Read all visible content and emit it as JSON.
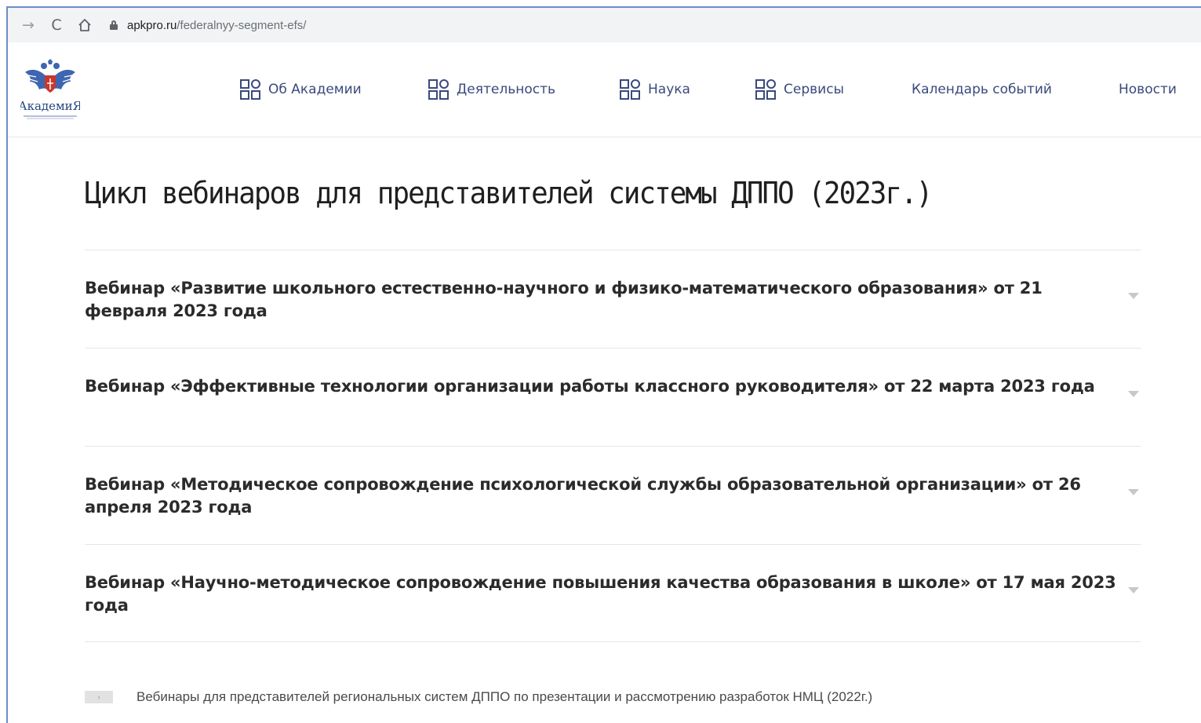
{
  "browser": {
    "url_host": "apkpro.ru",
    "url_path": "/federalnyy-segment-efs/",
    "forward_icon": "→",
    "reload_icon": "C",
    "home_icon": "⌂"
  },
  "header": {
    "logo_text": "АкадемиЯ",
    "nav": [
      {
        "label": "Об Академии",
        "icon": "grid-icon"
      },
      {
        "label": "Деятельность",
        "icon": "grid-icon"
      },
      {
        "label": "Наука",
        "icon": "grid-icon"
      },
      {
        "label": "Сервисы",
        "icon": "grid-icon"
      },
      {
        "label": "Календарь событий"
      },
      {
        "label": "Новости"
      }
    ]
  },
  "main": {
    "title": "Цикл вебинаров для представителей системы ДППО (2023г.)",
    "webinars": [
      {
        "title": "Вебинар «Развитие школьного естественно-научного и физико-математического образования» от 21 февраля 2023 года"
      },
      {
        "title": "Вебинар «Эффективные технологии организации работы классного руководителя» от 22 марта 2023 года"
      },
      {
        "title": "Вебинар «Методическое сопровождение психологической службы образовательной организации» от 26 апреля 2023 года"
      },
      {
        "title": "Вебинар «Научно-методическое сопровождение повышения качества образования в школе» от 17 мая 2023 года"
      }
    ],
    "footer_link": "Вебинары для представителей региональных систем ДППО по презентации и рассмотрению разработок НМЦ (2022г.)",
    "footer_bullet": "›"
  },
  "colors": {
    "nav_text": "#3a4a7c",
    "frame_border": "#6b8fc7"
  }
}
